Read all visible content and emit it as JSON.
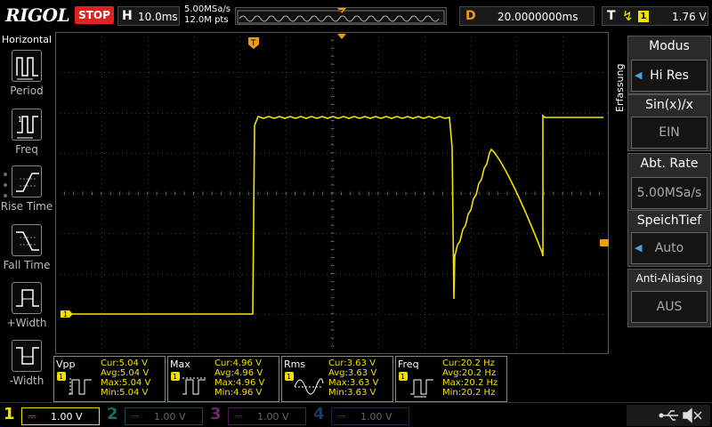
{
  "topbar": {
    "brand": "RIGOL",
    "run_status": "STOP",
    "horizontal_label": "H",
    "timebase": "10.0ms",
    "sample_rate": "5.00MSa/s",
    "points": "12.0M pts",
    "delay_label": "D",
    "delay_value": "20.0000000ms",
    "trigger_label": "T",
    "trigger_channel": "1",
    "trigger_level": "1.76 V"
  },
  "left_menu": {
    "title": "Horizontal",
    "items": [
      {
        "label": "Period",
        "icon": "period-icon"
      },
      {
        "label": "Freq",
        "icon": "frequency-icon"
      },
      {
        "label": "Rise Time",
        "icon": "rise-time-icon"
      },
      {
        "label": "Fall Time",
        "icon": "fall-time-icon"
      },
      {
        "label": "+Width",
        "icon": "positive-width-icon"
      },
      {
        "label": "-Width",
        "icon": "negative-width-icon"
      }
    ]
  },
  "right_menu": {
    "section": "Erfassung",
    "items": [
      {
        "title": "Modus",
        "value": "Hi Res"
      },
      {
        "title": "Sin(x)/x",
        "value": "EIN"
      },
      {
        "title": "Abt. Rate",
        "value": "5.00MSa/s"
      },
      {
        "title": "SpeichTief",
        "value": "Auto"
      },
      {
        "title": "Anti-Aliasing",
        "value": "AUS"
      }
    ]
  },
  "screen": {
    "trigger_marker": "T",
    "channel_marker": "1",
    "trace_color": "#f3e200",
    "trigger_color": "#f39c12"
  },
  "measurements": [
    {
      "name": "Vpp",
      "cur": "Cur:5.04 V",
      "avg": "Avg:5.04 V",
      "max": "Max:5.04 V",
      "min": "Min:5.04 V"
    },
    {
      "name": "Max",
      "cur": "Cur:4.96 V",
      "avg": "Avg:4.96 V",
      "max": "Max:4.96 V",
      "min": "Min:4.96 V"
    },
    {
      "name": "Rms",
      "cur": "Cur:3.63 V",
      "avg": "Avg:3.63 V",
      "max": "Max:3.63 V",
      "min": "Min:3.63 V"
    },
    {
      "name": "Freq",
      "cur": "Cur:20.2 Hz",
      "avg": "Avg:20.2 Hz",
      "max": "Max:20.2 Hz",
      "min": "Min:20.2 Hz"
    }
  ],
  "channels": [
    {
      "num": "1",
      "scale": "1.00 V"
    },
    {
      "num": "2",
      "scale": "1.00 V"
    },
    {
      "num": "3",
      "scale": "1.00 V"
    },
    {
      "num": "4",
      "scale": "1.00 V"
    }
  ]
}
